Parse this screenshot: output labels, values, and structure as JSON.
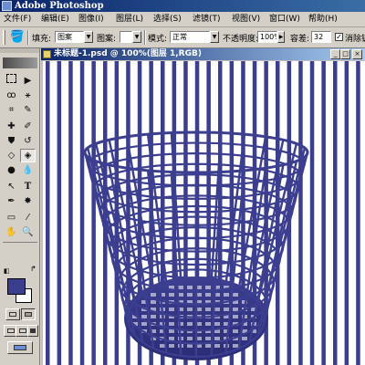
{
  "app": {
    "title": "Adobe Photoshop"
  },
  "menu": [
    "文件(F)",
    "编辑(E)",
    "图像(I)",
    "图层(L)",
    "选择(S)",
    "滤镜(T)",
    "视图(V)",
    "窗口(W)",
    "帮助(H)"
  ],
  "options": {
    "fill_label": "填充:",
    "fill_value": "图案",
    "pattern_label": "图案:",
    "mode_label": "模式:",
    "mode_value": "正常",
    "opacity_label": "不透明度:",
    "opacity_value": "100%",
    "tolerance_label": "容差:",
    "tolerance_value": "32",
    "antialias_label": "消除锯",
    "antialias_checked": true
  },
  "document": {
    "title": "未标题-1.psd @ 100%(图层 1,RGB)"
  },
  "colors": {
    "foreground": "#3b3d8f",
    "background": "#ffffff",
    "stripe": "#3b3d8f",
    "basket": "#3c3e90",
    "basket_bottom_dark": "#2a2c75"
  },
  "tools": [
    "marquee-icon",
    "move-icon",
    "lasso-icon",
    "magic-wand-icon",
    "crop-icon",
    "slice-icon",
    "healing-brush-icon",
    "brush-icon",
    "clone-stamp-icon",
    "history-brush-icon",
    "eraser-icon",
    "paint-bucket-icon",
    "dodge-icon",
    "blur-icon",
    "path-select-icon",
    "type-icon",
    "pen-icon",
    "custom-shape-icon",
    "notes-icon",
    "eyedropper-icon",
    "hand-icon",
    "zoom-icon"
  ]
}
